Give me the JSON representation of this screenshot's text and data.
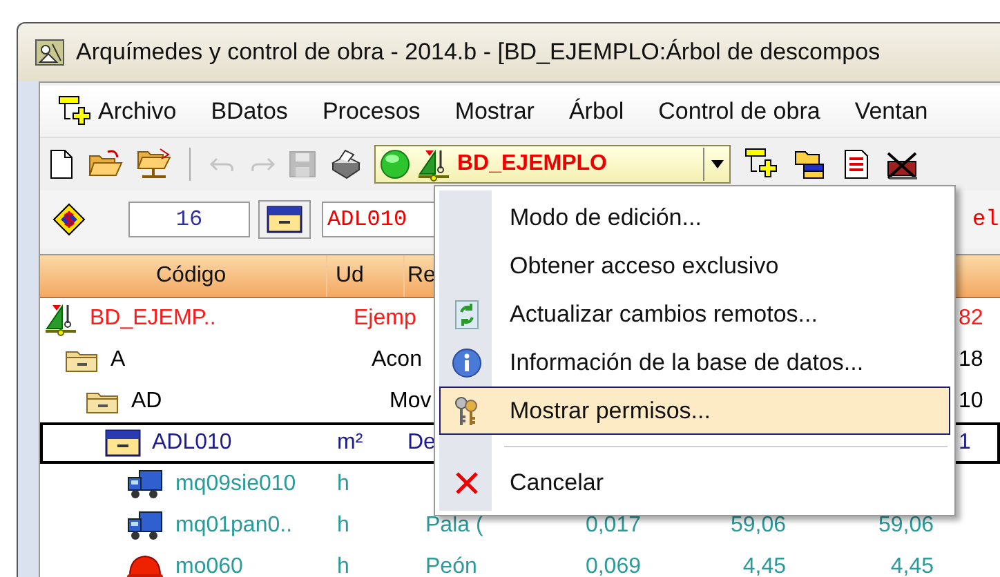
{
  "window": {
    "title": "Arquímedes y control de obra - 2014.b - [BD_EJEMPLO:Árbol de descompos"
  },
  "menu_bar": [
    {
      "label": "Archivo"
    },
    {
      "label": "BDatos"
    },
    {
      "label": "Procesos"
    },
    {
      "label": "Mostrar"
    },
    {
      "label": "Árbol"
    },
    {
      "label": "Control de obra"
    },
    {
      "label": "Ventan"
    }
  ],
  "toolbar": {
    "items": [
      {
        "kind": "button",
        "disabled": false
      },
      {
        "kind": "button",
        "disabled": false
      },
      {
        "kind": "button",
        "disabled": false
      },
      {
        "kind": "separator"
      },
      {
        "kind": "button",
        "disabled": true
      },
      {
        "kind": "button",
        "disabled": true
      },
      {
        "kind": "button",
        "disabled": true
      },
      {
        "kind": "button",
        "disabled": false
      },
      {
        "kind": "combo",
        "value": "BD_EJEMPLO"
      },
      {
        "kind": "button",
        "disabled": false
      },
      {
        "kind": "button",
        "disabled": false
      },
      {
        "kind": "button",
        "disabled": false
      },
      {
        "kind": "button",
        "disabled": false
      }
    ]
  },
  "code_bar": {
    "count": "16",
    "code": "ADL010",
    "field_3": "el"
  },
  "tree": {
    "columns": [
      "Código",
      "Ud",
      "Re"
    ],
    "rows": [
      {
        "kind": "database",
        "code": "BD_EJEMP..",
        "summary": "Ejemp",
        "column_7": "82",
        "color": "#ff1a1a",
        "selected": false,
        "children": [
          {
            "kind": "folder",
            "code": "A",
            "summary": "Acon",
            "column_7": "18",
            "color": "#000000",
            "selected": false,
            "children": [
              {
                "kind": "folder",
                "code": "AD",
                "summary": "Mov",
                "column_7": "10",
                "color": "#000000",
                "selected": false,
                "children": [
                  {
                    "kind": "item",
                    "code": "ADL010",
                    "unit": "m²",
                    "summary": "De",
                    "column_7": "1",
                    "color": "#1c1c8c",
                    "selected": true,
                    "children": [
                      {
                        "kind": "machine",
                        "code": "mq09sie010",
                        "unit": "h",
                        "color": "#2a9a9a",
                        "selected": false
                      },
                      {
                        "kind": "machine",
                        "code": "mq01pan0..",
                        "unit": "h",
                        "summary": "Pala (",
                        "column_4": "0,017",
                        "column_5": "59,06",
                        "column_6": "59,06",
                        "color": "#2a9a9a",
                        "selected": false
                      },
                      {
                        "kind": "labor",
                        "code": "mo060",
                        "unit": "h",
                        "summary": "Peón",
                        "column_4": "0,069",
                        "column_5": "4,45",
                        "column_6": "4,45",
                        "color": "#2a9a9a",
                        "selected": false
                      }
                    ]
                  }
                ]
              }
            ]
          }
        ]
      }
    ]
  },
  "menu": {
    "items": [
      {
        "kind": "item",
        "label": "Modo de edición...",
        "selected": false
      },
      {
        "kind": "item",
        "label": "Obtener acceso exclusivo",
        "selected": false
      },
      {
        "kind": "item",
        "label": "Actualizar cambios remotos...",
        "selected": false
      },
      {
        "kind": "item",
        "label": "Información de la base de datos...",
        "selected": false
      },
      {
        "kind": "item",
        "label": "Mostrar permisos...",
        "selected": true
      },
      {
        "kind": "separator"
      },
      {
        "kind": "item",
        "label": "Cancelar",
        "selected": false
      }
    ]
  }
}
